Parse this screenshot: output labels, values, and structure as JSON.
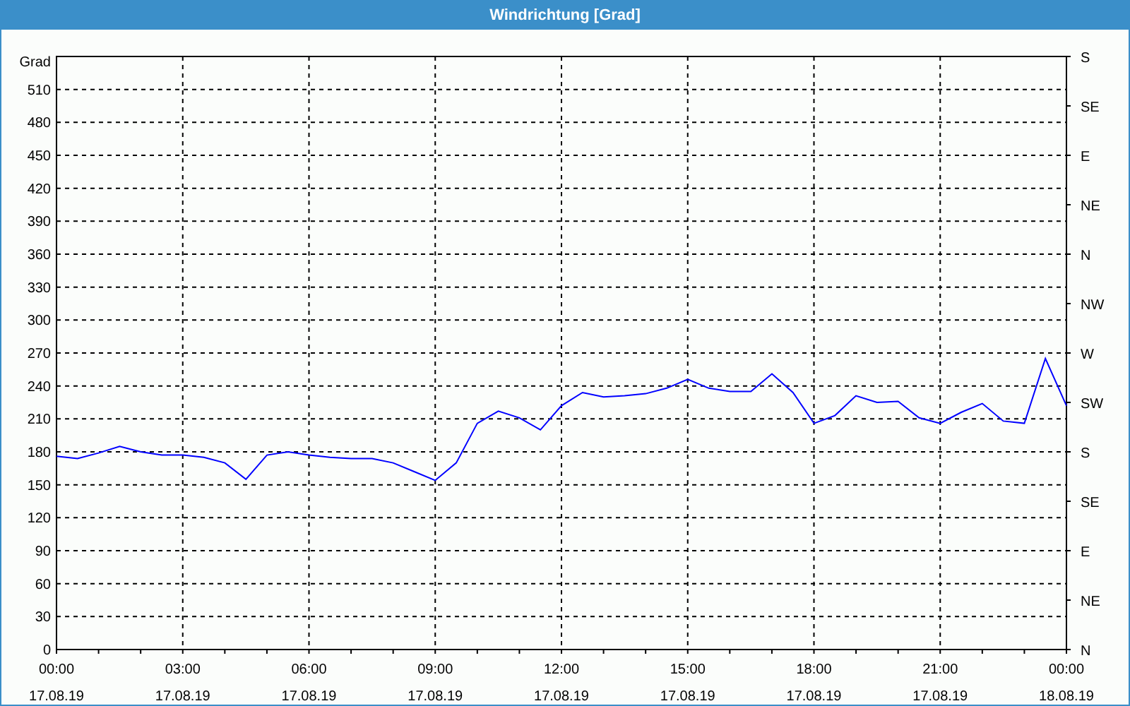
{
  "window": {
    "title": "Windrichtung [Grad]"
  },
  "compass_axis": {
    "labels": [
      "S",
      "SE",
      "E",
      "NE",
      "N",
      "NW",
      "W",
      "SW",
      "S",
      "SE",
      "E",
      "NE",
      "N"
    ]
  },
  "chart_data": {
    "type": "line",
    "grid": true,
    "ylabel": "Grad",
    "ylim": [
      0,
      540
    ],
    "yticks": [
      0,
      30,
      60,
      90,
      120,
      150,
      180,
      210,
      240,
      270,
      300,
      330,
      360,
      390,
      420,
      450,
      480,
      510
    ],
    "categories": [
      "00:00\n17.08.19",
      null,
      null,
      null,
      null,
      null,
      "03:00\n17.08.19",
      null,
      null,
      null,
      null,
      null,
      "06:00\n17.08.19",
      null,
      null,
      null,
      null,
      null,
      "09:00\n17.08.19",
      null,
      null,
      null,
      null,
      null,
      "12:00\n17.08.19",
      null,
      null,
      null,
      null,
      null,
      "15:00\n17.08.19",
      null,
      null,
      null,
      null,
      null,
      "18:00\n17.08.19",
      null,
      null,
      null,
      null,
      null,
      "21:00\n17.08.19",
      null,
      null,
      null,
      null,
      null,
      "00:00\n18.08.19"
    ],
    "series": [
      {
        "color": "#0000ff",
        "values": [
          176,
          174,
          179,
          185,
          180,
          177,
          177,
          175,
          170,
          155,
          177,
          180,
          177,
          175,
          174,
          174,
          170,
          162,
          154,
          170,
          206,
          217,
          211,
          200,
          222,
          234,
          230,
          231,
          233,
          238,
          246,
          238,
          235,
          235,
          251,
          234,
          206,
          213,
          231,
          225,
          226,
          211,
          206,
          216,
          224,
          208,
          206,
          265,
          222
        ]
      }
    ]
  }
}
